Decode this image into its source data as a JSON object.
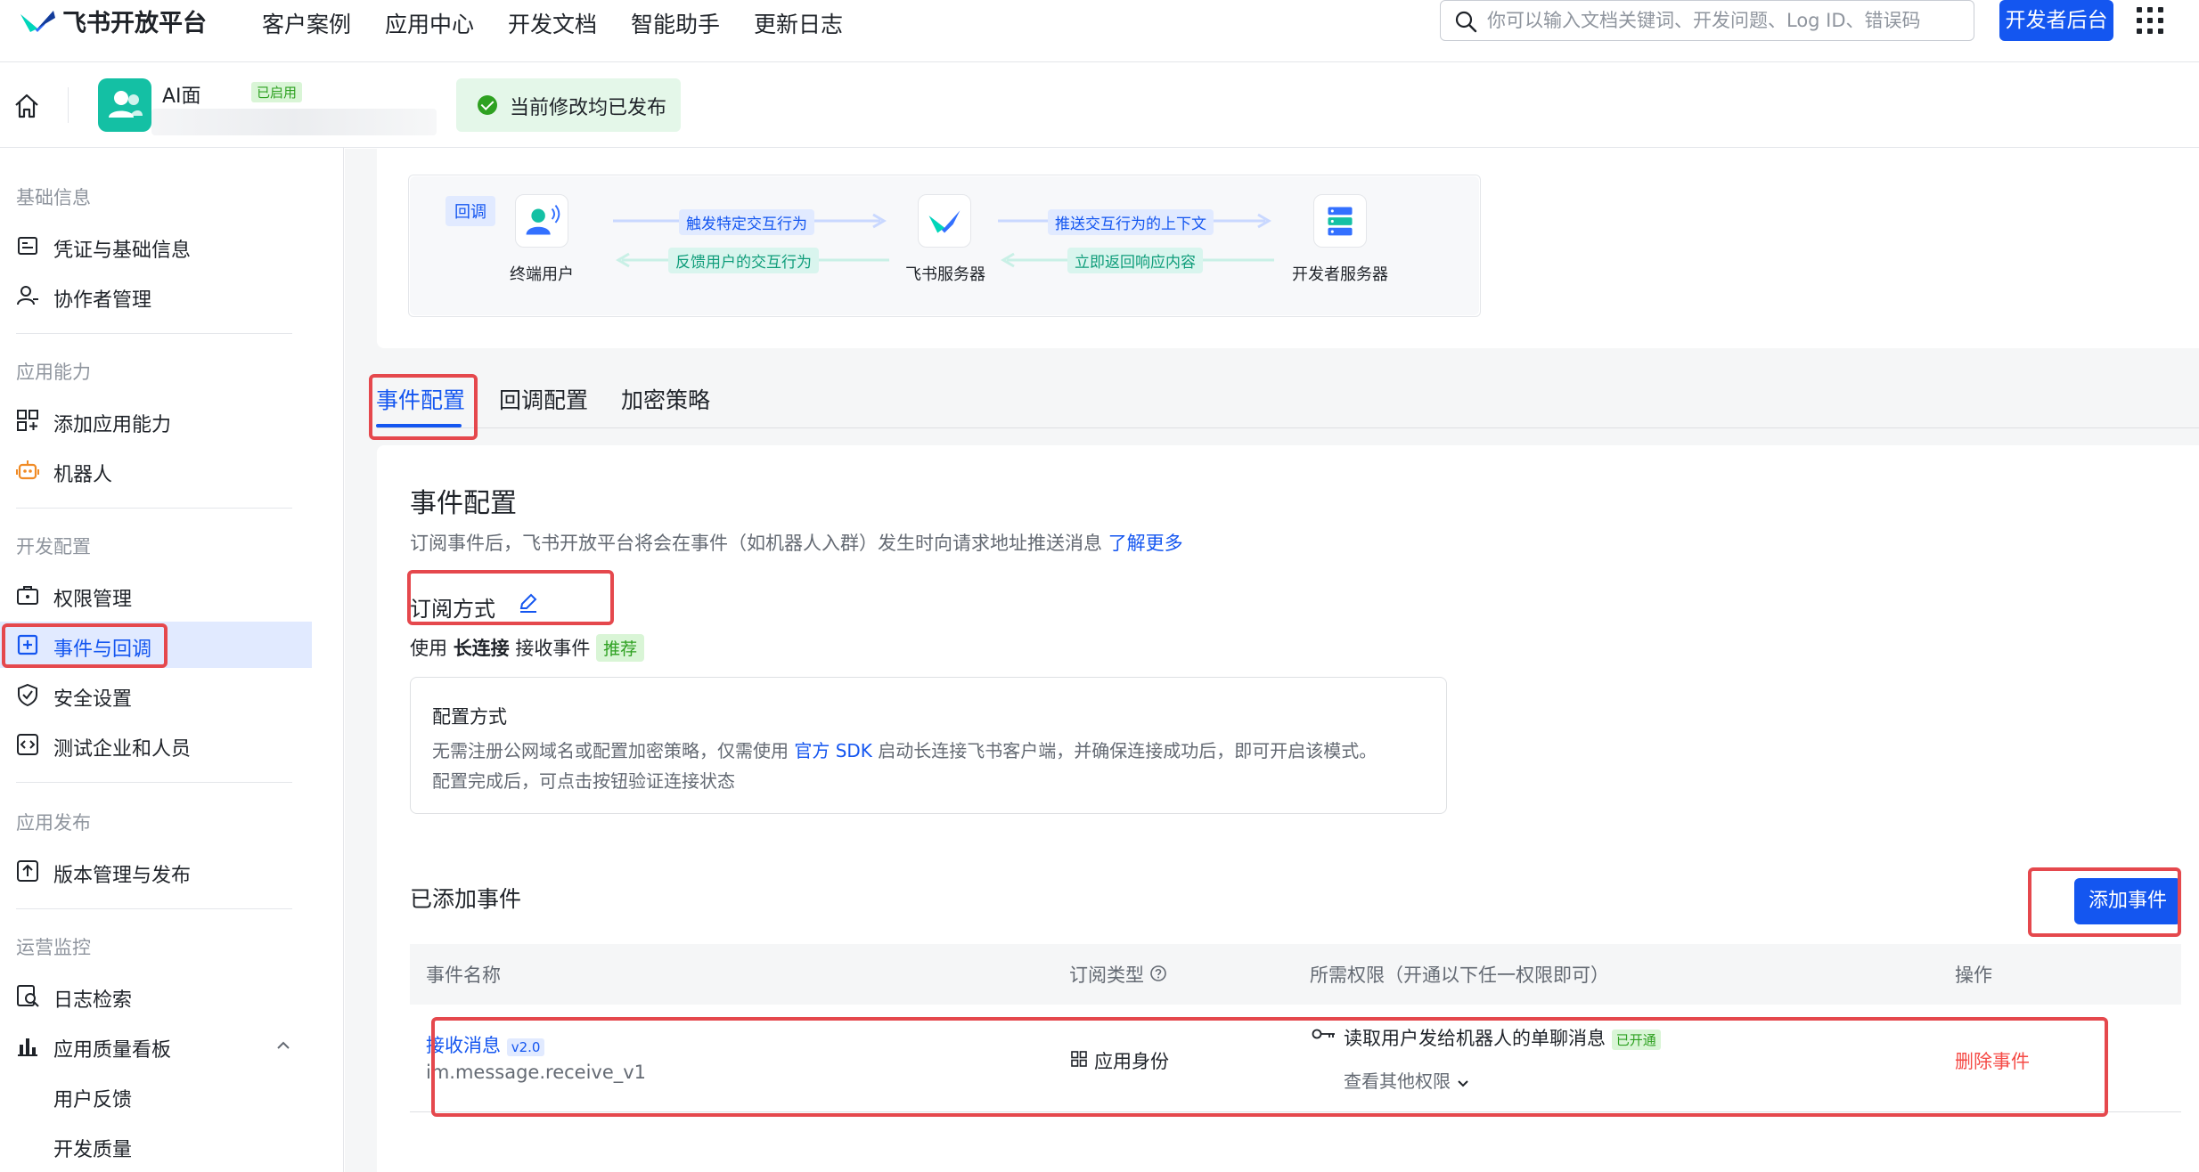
{
  "topnav": {
    "brand": "飞书开放平台",
    "links": [
      "客户案例",
      "应用中心",
      "开发文档",
      "智能助手",
      "更新日志"
    ],
    "search_placeholder": "你可以输入文档关键词、开发问题、Log ID、错误码",
    "dev_console": "开发者后台"
  },
  "appbar": {
    "app_name": "AI面",
    "app_status": "已启用",
    "publish_status": "当前修改均已发布"
  },
  "sidebar": {
    "groups": [
      {
        "title": "基础信息",
        "items": [
          "凭证与基础信息",
          "协作者管理"
        ]
      },
      {
        "title": "应用能力",
        "items": [
          "添加应用能力",
          "机器人"
        ]
      },
      {
        "title": "开发配置",
        "items": [
          "权限管理",
          "事件与回调",
          "安全设置",
          "测试企业和人员"
        ]
      },
      {
        "title": "应用发布",
        "items": [
          "版本管理与发布"
        ]
      },
      {
        "title": "运营监控",
        "items": [
          "日志检索",
          "应用质量看板"
        ]
      }
    ],
    "sub_items": [
      "用户反馈",
      "开发质量"
    ],
    "active_item": "事件与回调"
  },
  "flow": {
    "tag": "回调",
    "nodes": [
      "终端用户",
      "飞书服务器",
      "开发者服务器"
    ],
    "arrows_left": [
      "触发特定交互行为",
      "反馈用户的交互行为"
    ],
    "arrows_right": [
      "推送交互行为的上下文",
      "立即返回响应内容"
    ]
  },
  "tabs": [
    "事件配置",
    "回调配置",
    "加密策略"
  ],
  "event_config": {
    "title": "事件配置",
    "desc": "订阅事件后，飞书开放平台将会在事件（如机器人入群）发生时向请求地址推送消息",
    "learn_more": "了解更多",
    "sub_mode_label": "订阅方式",
    "use_prefix": "使用",
    "use_mode": "长连接",
    "use_suffix": "接收事件",
    "recommend_tag": "推荐",
    "config_title": "配置方式",
    "config_desc_1a": "无需注册公网域名或配置加密策略，仅需使用",
    "config_desc_link": "官方 SDK",
    "config_desc_1b": "启动长连接飞书客户端，并确保连接成功后，即可开启该模式。",
    "config_desc_2": "配置完成后，可点击按钮验证连接状态"
  },
  "added_events": {
    "title": "已添加事件",
    "add_button": "添加事件",
    "columns": [
      "事件名称",
      "订阅类型",
      "所需权限（开通以下任一权限即可）",
      "操作"
    ],
    "rows": [
      {
        "name": "接收消息",
        "version": "v2.0",
        "code": "im.message.receive_v1",
        "sub_type": "应用身份",
        "permission": "读取用户发给机器人的单聊消息",
        "perm_status": "已开通",
        "more_perms": "查看其他权限",
        "action": "删除事件"
      }
    ]
  }
}
